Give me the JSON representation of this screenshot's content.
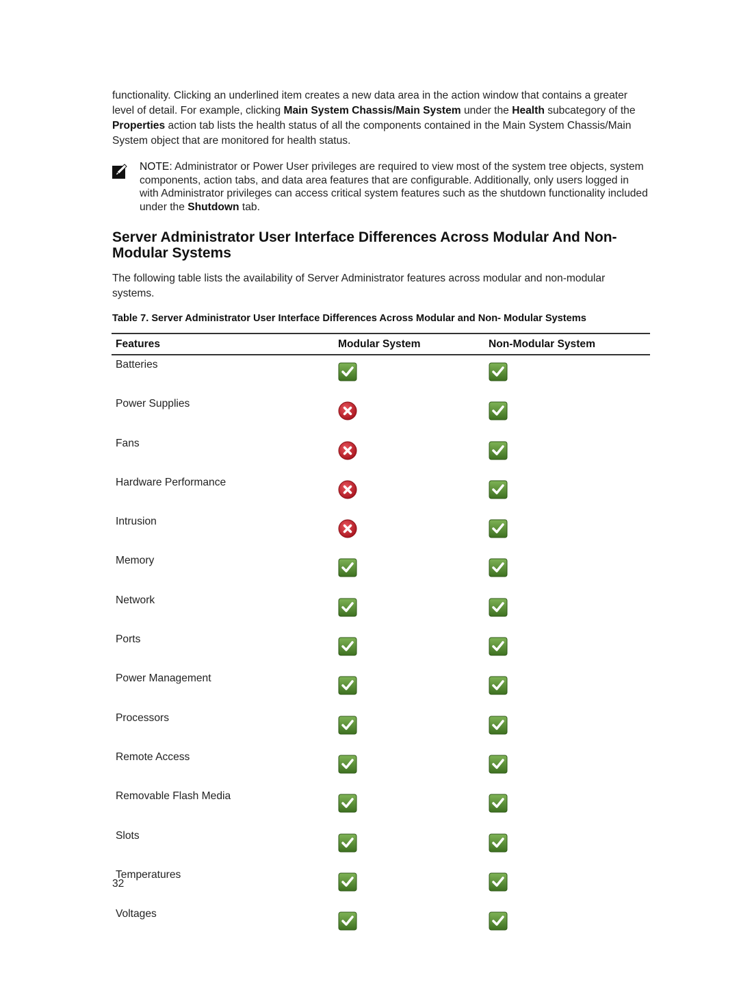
{
  "intro": {
    "t1": "functionality. Clicking an underlined item creates a new data area in the action window that contains a greater level of detail. For example, clicking ",
    "b1": "Main System Chassis/Main System",
    "t2": " under the ",
    "b2": "Health",
    "t3": " subcategory of the ",
    "b3": "Properties",
    "t4": " action tab lists the health status of all the components contained in the Main System Chassis/Main System object that are monitored for health status."
  },
  "note": {
    "icon": "note-pencil-icon",
    "label": "NOTE:",
    "t1": " Administrator or Power User privileges are required to view most of the system tree objects, system components, action tabs, and data area features that are configurable. Additionally, only users logged in with Administrator privileges can access critical system features such as the shutdown functionality included under the ",
    "b1": "Shutdown",
    "t2": " tab."
  },
  "heading": "Server Administrator User Interface Differences Across Modular And Non-Modular Systems",
  "lead": "The following table lists the availability of Server Administrator features across modular and non-modular systems.",
  "caption": "Table 7. Server Administrator User Interface Differences Across Modular and Non- Modular Systems",
  "table": {
    "headers": [
      "Features",
      "Modular System",
      "Non-Modular System"
    ],
    "rows": [
      {
        "feature": "Batteries",
        "modular": "check",
        "nonmodular": "check"
      },
      {
        "feature": "Power Supplies",
        "modular": "cross",
        "nonmodular": "check"
      },
      {
        "feature": "Fans",
        "modular": "cross",
        "nonmodular": "check"
      },
      {
        "feature": "Hardware Performance",
        "modular": "cross",
        "nonmodular": "check"
      },
      {
        "feature": "Intrusion",
        "modular": "cross",
        "nonmodular": "check"
      },
      {
        "feature": "Memory",
        "modular": "check",
        "nonmodular": "check"
      },
      {
        "feature": "Network",
        "modular": "check",
        "nonmodular": "check"
      },
      {
        "feature": "Ports",
        "modular": "check",
        "nonmodular": "check"
      },
      {
        "feature": "Power Management",
        "modular": "check",
        "nonmodular": "check"
      },
      {
        "feature": "Processors",
        "modular": "check",
        "nonmodular": "check"
      },
      {
        "feature": "Remote Access",
        "modular": "check",
        "nonmodular": "check"
      },
      {
        "feature": "Removable Flash Media",
        "modular": "check",
        "nonmodular": "check"
      },
      {
        "feature": "Slots",
        "modular": "check",
        "nonmodular": "check"
      },
      {
        "feature": "Temperatures",
        "modular": "check",
        "nonmodular": "check"
      },
      {
        "feature": "Voltages",
        "modular": "check",
        "nonmodular": "check"
      }
    ]
  },
  "colors": {
    "check": "#4e8a2c",
    "cross": "#c8202a"
  },
  "page_number": "32"
}
